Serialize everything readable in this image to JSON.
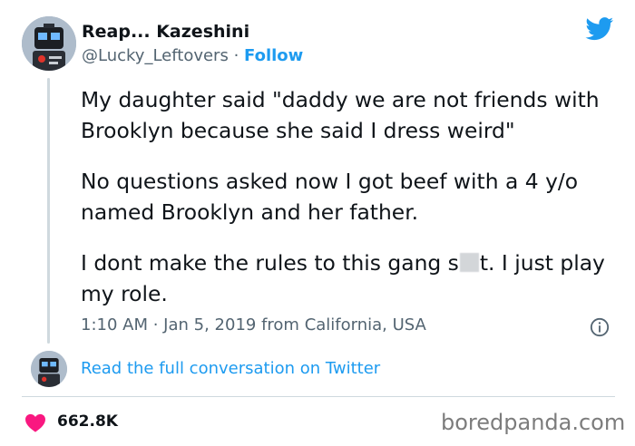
{
  "author": {
    "display_name": "Reap... Kazeshini",
    "handle": "@Lucky_Leftovers",
    "separator": " · ",
    "follow_label": "Follow"
  },
  "tweet": {
    "line_1_before_blur": "My daughter said \"daddy we are not friends with Brooklyn because she said I dress weird\"",
    "paragraph_2": "No questions asked now I got beef with a 4 y/o named Brooklyn and her father.",
    "paragraph_3_start": "I dont make the rules to this gang s",
    "paragraph_3_end": "t. I just play my role."
  },
  "meta": {
    "time": "1:10 AM",
    "separator": " · ",
    "date": "Jan 5, 2019",
    "source": " from California, USA"
  },
  "conversation_link": "Read the full conversation on Twitter",
  "likes": {
    "count": "662.8K"
  },
  "watermark": "boredpanda.com",
  "colors": {
    "link_blue": "#1d9bf0",
    "heart_red": "#f91880",
    "muted_text": "#536471"
  },
  "icons": [
    "twitter-bird-icon",
    "info-icon",
    "heart-icon"
  ]
}
